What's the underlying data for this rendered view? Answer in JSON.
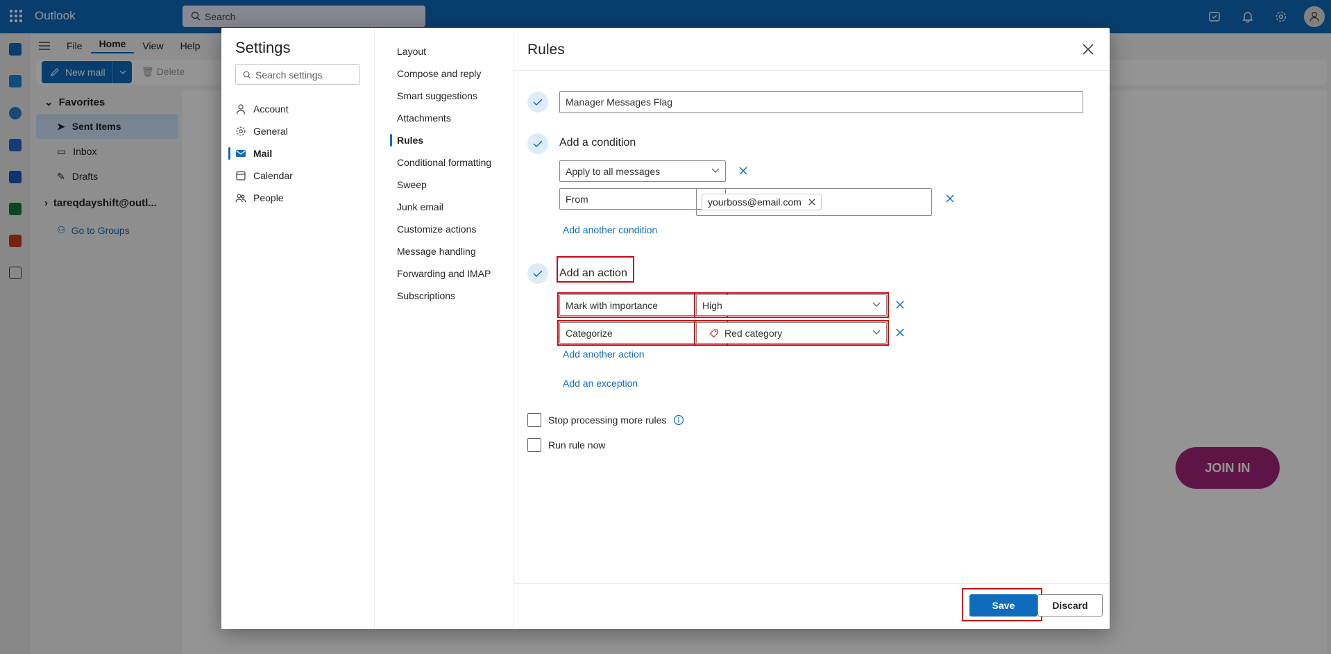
{
  "app": {
    "title": "Outlook",
    "search_placeholder": "Search",
    "ribbon_tabs": [
      "File",
      "Home",
      "View",
      "Help"
    ],
    "new_mail_label": "New mail",
    "delete_label": "Delete",
    "favorites_label": "Favorites",
    "folders": [
      "Sent Items",
      "Inbox",
      "Drafts"
    ],
    "account_label": "tareqdayshift@outl...",
    "groups_label": "Go to Groups",
    "ad_label": "JOIN IN"
  },
  "settings": {
    "title": "Settings",
    "search_placeholder": "Search settings",
    "nav": [
      {
        "label": "Account",
        "icon": "person-icon"
      },
      {
        "label": "General",
        "icon": "gear-icon"
      },
      {
        "label": "Mail",
        "icon": "mail-icon",
        "selected": true
      },
      {
        "label": "Calendar",
        "icon": "calendar-icon"
      },
      {
        "label": "People",
        "icon": "people-icon"
      }
    ],
    "sub_nav": [
      "Layout",
      "Compose and reply",
      "Smart suggestions",
      "Attachments",
      "Rules",
      "Conditional formatting",
      "Sweep",
      "Junk email",
      "Customize actions",
      "Message handling",
      "Forwarding and IMAP",
      "Subscriptions"
    ],
    "sub_nav_selected": "Rules"
  },
  "rules": {
    "title": "Rules",
    "rule_name": "Manager Messages Flag",
    "condition_heading": "Add a condition",
    "condition_1": "Apply to all messages",
    "condition_2": "From",
    "condition_2_value": "yourboss@email.com",
    "add_condition_link": "Add another condition",
    "action_heading": "Add an action",
    "action_1": "Mark with importance",
    "action_1_value": "High",
    "action_2": "Categorize",
    "action_2_value": "Red category",
    "add_action_link": "Add another action",
    "add_exception_link": "Add an exception",
    "stop_processing_label": "Stop processing more rules",
    "run_now_label": "Run rule now",
    "save_label": "Save",
    "discard_label": "Discard"
  },
  "colors": {
    "brand": "#0f6cbd",
    "highlight": "#d0000f",
    "category_red": "#d13438"
  }
}
